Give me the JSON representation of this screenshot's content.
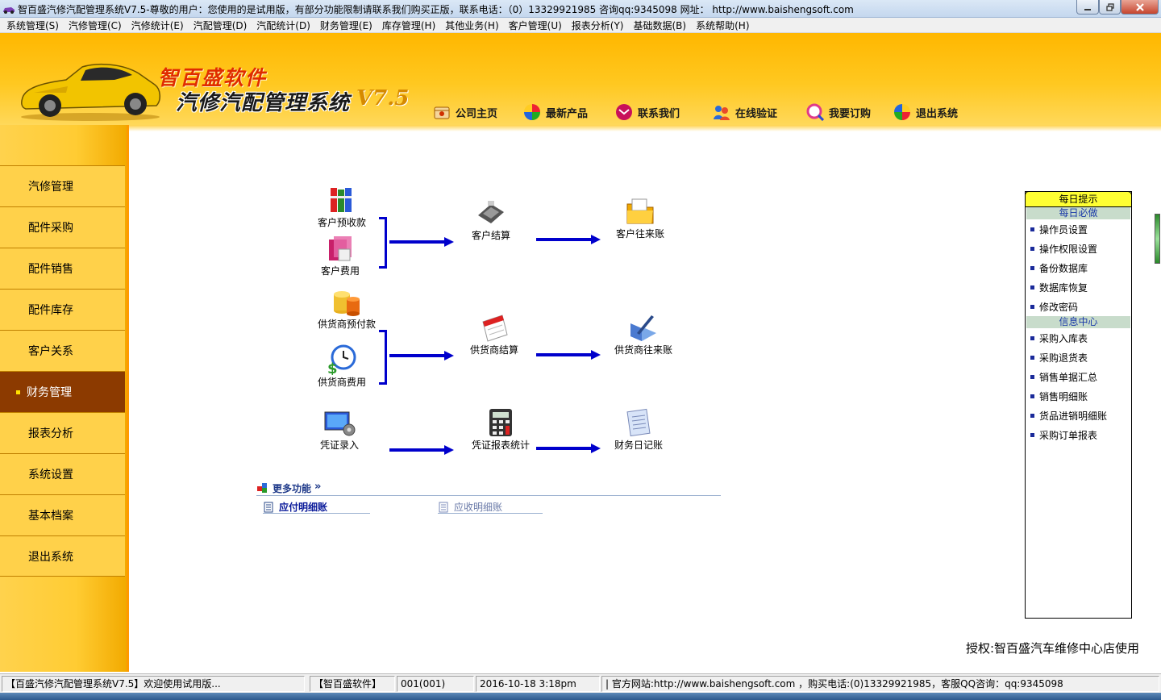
{
  "window": {
    "title": "智百盛汽修汽配管理系统V7.5-尊敬的用户：您使用的是试用版，有部分功能限制请联系我们购买正版，联系电话：（0）13329921985 咨询qq:9345098    网址： http://www.baishengsoft.com"
  },
  "menu": [
    "系统管理(S)",
    "汽修管理(C)",
    "汽修统计(E)",
    "汽配管理(D)",
    "汽配统计(D)",
    "财务管理(E)",
    "库存管理(H)",
    "其他业务(H)",
    "客户管理(U)",
    "报表分析(Y)",
    "基础数据(B)",
    "系统帮助(H)"
  ],
  "banner": {
    "brand_line1": "智百盛软件",
    "brand_line2": "汽修汽配管理系统",
    "brand_version": "V7.5",
    "nav": [
      "公司主页",
      "最新产品",
      "联系我们",
      "在线验证",
      "我要订购",
      "退出系统"
    ]
  },
  "sidebar": [
    "汽修管理",
    "配件采购",
    "配件销售",
    "配件库存",
    "客户关系",
    "财务管理",
    "报表分析",
    "系统设置",
    "基本档案",
    "退出系统"
  ],
  "flow": {
    "customer_prepay": "客户预收款",
    "customer_expense": "客户费用",
    "customer_settle": "客户结算",
    "customer_ledger": "客户往来账",
    "supplier_prepay": "供货商预付款",
    "supplier_expense": "供货商费用",
    "supplier_settle": "供货商结算",
    "supplier_ledger": "供货商往来账",
    "voucher_entry": "凭证录入",
    "voucher_report": "凭证报表统计",
    "finance_journal": "财务日记账"
  },
  "more": {
    "title": "更多功能",
    "arrows": "»",
    "payable": "应付明细账",
    "receivable": "应收明细账"
  },
  "tips": {
    "title": "每日提示",
    "daily_head": "每日必做",
    "daily": [
      "操作员设置",
      "操作权限设置",
      "备份数据库",
      "数据库恢复",
      "修改密码"
    ],
    "info_head": "信息中心",
    "info": [
      "采购入库表",
      "采购退货表",
      "销售单据汇总",
      "销售明细账",
      "货品进销明细账",
      "采购订单报表"
    ]
  },
  "license": "授权:智百盛汽车维修中心店使用",
  "status": {
    "welcome": "【百盛汽修汽配管理系统V7.5】欢迎使用试用版...",
    "company": "【智百盛软件】",
    "user": "001(001)",
    "datetime": "2016-10-18 3:18pm",
    "contact": "|  官方网站:http://www.baishengsoft.com ，购买电话:(0)13329921985，客服QQ咨询：qq:9345098"
  },
  "colors": {
    "banner": "#ffc820",
    "sidebar_active": "#8c3a00",
    "flow_arrow": "#0000cc",
    "tips_header": "#ffff33"
  }
}
